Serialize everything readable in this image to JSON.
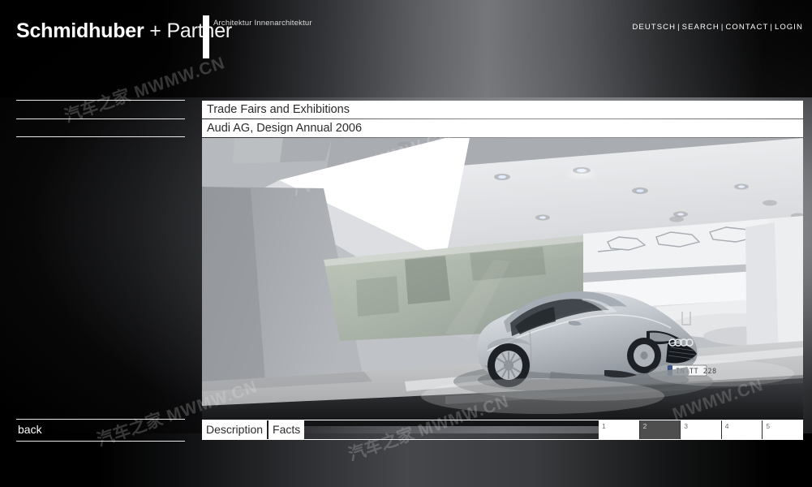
{
  "site": {
    "logo_bold": "Schmidhuber",
    "logo_light": " + Partner",
    "subtitle": "Architektur  Innenarchitektur"
  },
  "topnav": {
    "items": [
      {
        "label": "DEUTSCH"
      },
      {
        "label": "SEARCH"
      },
      {
        "label": "CONTACT"
      },
      {
        "label": "LOGIN"
      }
    ],
    "separator": "|"
  },
  "sidebar": {
    "rules": [
      "",
      "",
      ""
    ],
    "back_label": "back"
  },
  "content": {
    "category_title": "Trade Fairs and Exhibitions",
    "project_title": "Audi AG, Design Annual  2006"
  },
  "tabs": [
    {
      "label": "Description",
      "selected": true
    },
    {
      "label": "Facts",
      "selected": false
    }
  ],
  "pager": {
    "pages": [
      {
        "label": "1",
        "active": false
      },
      {
        "label": "2",
        "active": true
      },
      {
        "label": "3",
        "active": false
      },
      {
        "label": "4",
        "active": false
      },
      {
        "label": "5",
        "active": false
      }
    ]
  },
  "photo": {
    "alt": "Audi TT coupe on a white exhibition stand with angular illuminated ceiling",
    "license_plate": "IN-TT 228",
    "brand_mark": "audi-rings"
  },
  "watermark": {
    "latin": "MWMW.CN",
    "cjk": "汽车之家"
  },
  "colors": {
    "page_background": "#000000",
    "panel_white": "#ffffff",
    "text_dark": "#2b2b2b",
    "rule": "#e8e8e8",
    "pager_active": "#4e4e4e",
    "pager_number": "#6b6b6b"
  }
}
